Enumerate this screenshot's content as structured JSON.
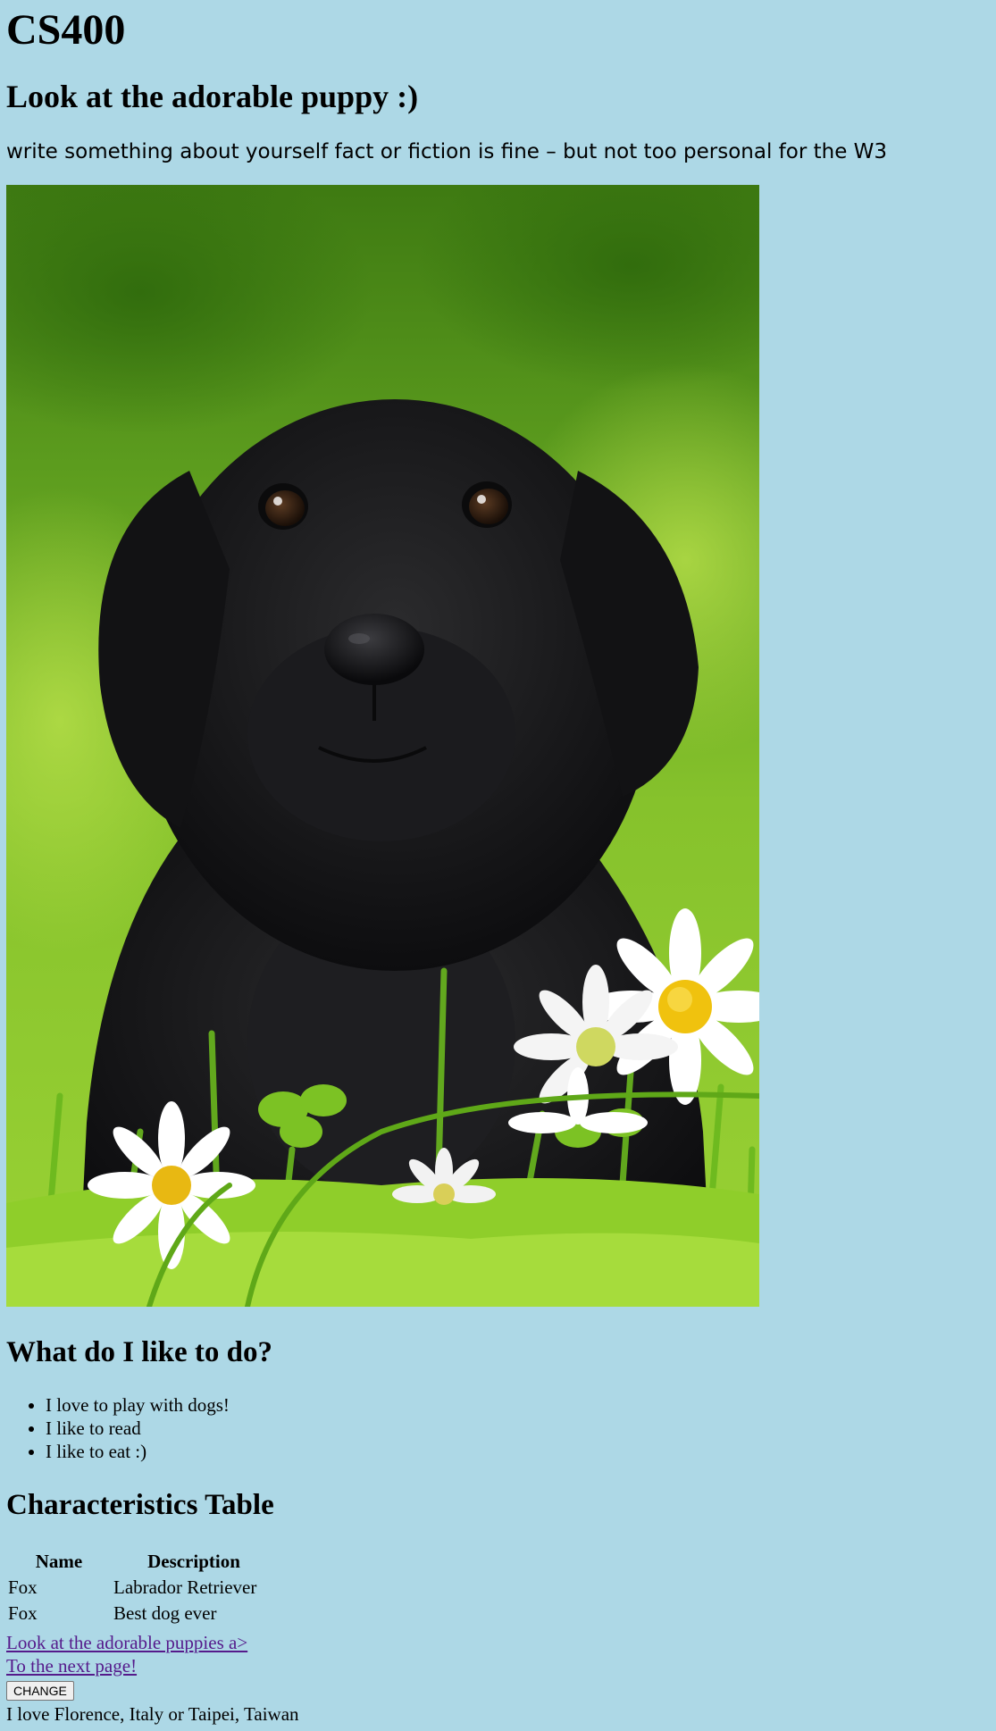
{
  "header": {
    "title": "CS400",
    "subtitle": "Look at the adorable puppy :)",
    "intro": "write something about yourself fact or fiction is fine – but not too personal for the W3"
  },
  "likes": {
    "title": "What do I like to do?",
    "items": [
      "I love to play with dogs!",
      "I like to read",
      "I like to eat :)"
    ]
  },
  "characteristics": {
    "title": "Characteristics Table",
    "headers": [
      "Name",
      "Description"
    ],
    "rows": [
      [
        "Fox",
        "Labrador Retriever"
      ],
      [
        "Fox",
        "Best dog ever"
      ]
    ]
  },
  "links": {
    "puppies": "Look at the adorable puppies a>",
    "next_page": "To the next page!"
  },
  "button": {
    "label": "CHANGE"
  },
  "footer": {
    "text": "I love Florence, Italy or Taipei, Taiwan"
  },
  "colors": {
    "background": "#add8e6",
    "visited_link": "#551a8b"
  }
}
